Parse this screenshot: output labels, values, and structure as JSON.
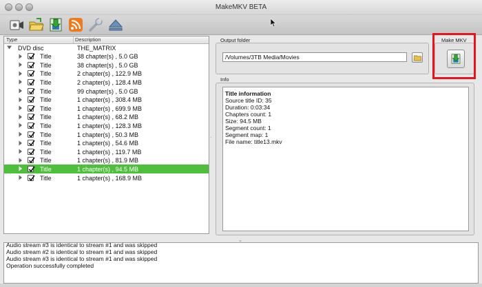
{
  "window": {
    "title": "MakeMKV BETA"
  },
  "toolbar": {
    "buttons": [
      {
        "name": "open-dvd-icon"
      },
      {
        "name": "open-files-icon"
      },
      {
        "name": "make-mkv-icon"
      },
      {
        "name": "stream-icon"
      },
      {
        "name": "preferences-wrench-icon"
      },
      {
        "name": "eject-icon"
      }
    ]
  },
  "tree": {
    "headers": {
      "type": "Type",
      "description": "Description"
    },
    "root": {
      "label": "DVD disc",
      "description": "THE_MATRIX"
    },
    "rows": [
      {
        "label": "Title",
        "description": "38 chapter(s) , 5.0 GB",
        "checked": true,
        "selected": false
      },
      {
        "label": "Title",
        "description": "38 chapter(s) , 5.0 GB",
        "checked": true,
        "selected": false
      },
      {
        "label": "Title",
        "description": "2 chapter(s) , 122.9 MB",
        "checked": true,
        "selected": false
      },
      {
        "label": "Title",
        "description": "2 chapter(s) , 128.4 MB",
        "checked": true,
        "selected": false
      },
      {
        "label": "Title",
        "description": "99 chapter(s) , 5.0 GB",
        "checked": true,
        "selected": false
      },
      {
        "label": "Title",
        "description": "1 chapter(s) , 308.4 MB",
        "checked": true,
        "selected": false
      },
      {
        "label": "Title",
        "description": "1 chapter(s) , 699.9 MB",
        "checked": true,
        "selected": false
      },
      {
        "label": "Title",
        "description": "1 chapter(s) , 68.2 MB",
        "checked": true,
        "selected": false
      },
      {
        "label": "Title",
        "description": "1 chapter(s) , 128.3 MB",
        "checked": true,
        "selected": false
      },
      {
        "label": "Title",
        "description": "1 chapter(s) , 50.3 MB",
        "checked": true,
        "selected": false
      },
      {
        "label": "Title",
        "description": "1 chapter(s) , 54.6 MB",
        "checked": true,
        "selected": false
      },
      {
        "label": "Title",
        "description": "1 chapter(s) , 119.7 MB",
        "checked": true,
        "selected": false
      },
      {
        "label": "Title",
        "description": "1 chapter(s) , 81.9 MB",
        "checked": true,
        "selected": false
      },
      {
        "label": "Title",
        "description": "1 chapter(s) , 94.5 MB",
        "checked": true,
        "selected": true
      },
      {
        "label": "Title",
        "description": "1 chapter(s) , 168.9 MB",
        "checked": true,
        "selected": false
      }
    ]
  },
  "output": {
    "group_title": "Output folder",
    "path": "/Volumes/3TB Media/Movies"
  },
  "make_mkv": {
    "group_title": "Make MKV"
  },
  "info": {
    "group_title": "Info",
    "title": "Title information",
    "lines": [
      "Source title ID: 35",
      "Duration: 0:03:34",
      "Chapters count: 1",
      "Size: 94.5 MB",
      "Segment count: 1",
      "Segment map: 1",
      "File name: title13.mkv"
    ]
  },
  "log": {
    "lines": [
      "Audio stream #3 is identical to stream #1 and was skipped",
      "Audio stream #2 is identical to stream #1 and was skipped",
      "Audio stream #3 is identical to stream #1 and was skipped",
      "Operation successfully completed"
    ]
  },
  "colors": {
    "selection": "#4ebf3b",
    "highlight": "#e8141b"
  }
}
